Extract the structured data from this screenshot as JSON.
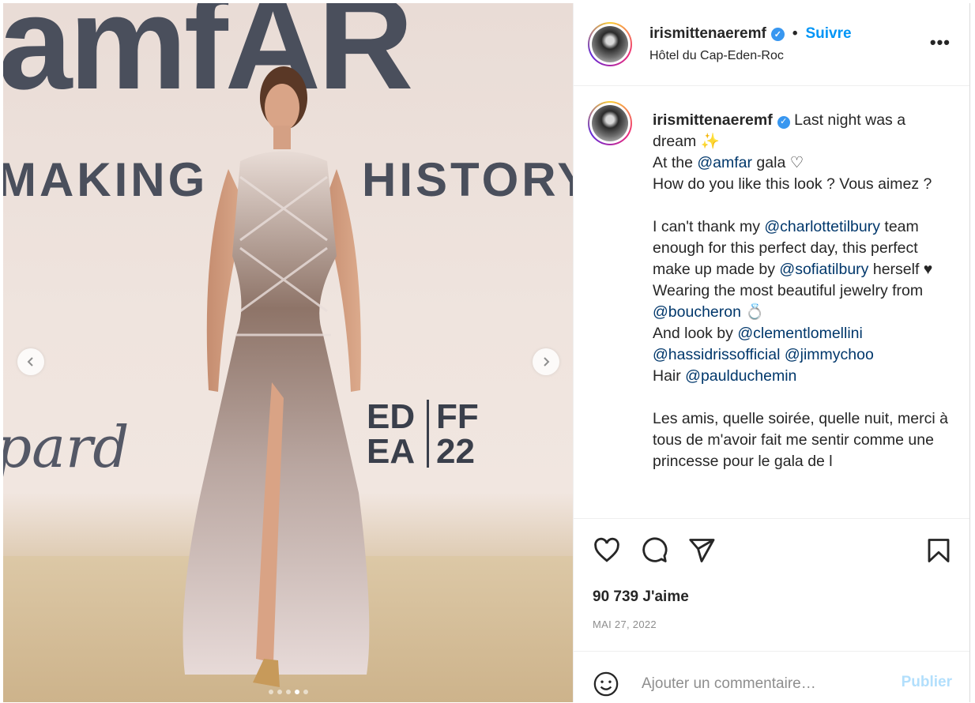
{
  "photo": {
    "wall_text_top": "amfAR",
    "wall_text_making": "MAKING",
    "wall_text_history": "HISTORY",
    "wall_text_sponsor": "pard",
    "festival_lines": [
      "ED",
      "FF",
      "EA",
      "22"
    ],
    "carousel": {
      "count": 5,
      "active_index": 3
    }
  },
  "post": {
    "username": "irismittenaeremf",
    "separator": "•",
    "follow_label": "Suivre",
    "location": "Hôtel du Cap-Eden-Roc"
  },
  "caption": {
    "username": "irismittenaeremf",
    "segments": [
      {
        "t": " Last night was a dream ✨\nAt the "
      },
      {
        "m": "@amfar"
      },
      {
        "t": " gala ♡\nHow do you like this look ? Vous aimez ?\n\nI can't thank my "
      },
      {
        "m": "@charlottetilbury"
      },
      {
        "t": " team enough for this perfect day, this perfect make up made by "
      },
      {
        "m": "@sofiatilbury"
      },
      {
        "t": " herself ♥\nWearing the most beautiful jewelry from "
      },
      {
        "m": "@boucheron"
      },
      {
        "t": " 💍\nAnd look by "
      },
      {
        "m": "@clementlomellini"
      },
      {
        "t": "\n"
      },
      {
        "m": "@hassidrissofficial"
      },
      {
        "t": " "
      },
      {
        "m": "@jimmychoo"
      },
      {
        "t": "\nHair "
      },
      {
        "m": "@paulduchemin"
      },
      {
        "t": "\n\nLes amis, quelle soirée, quelle nuit, merci à tous de m'avoir fait me sentir comme une princesse pour le gala de l"
      }
    ]
  },
  "actions": {
    "likes": "90 739 J'aime",
    "date": "MAI 27, 2022"
  },
  "comment": {
    "placeholder": "Ajouter un commentaire…",
    "publish_label": "Publier"
  },
  "icons": [
    "chevron-left-icon",
    "chevron-right-icon",
    "verified-icon",
    "more-icon",
    "heart-icon",
    "comment-icon",
    "share-icon",
    "bookmark-icon",
    "emoji-icon"
  ],
  "colors": {
    "link": "#0095f6",
    "mention": "#00376b",
    "verified": "#3897f0",
    "publish_disabled": "#b2dffc"
  }
}
